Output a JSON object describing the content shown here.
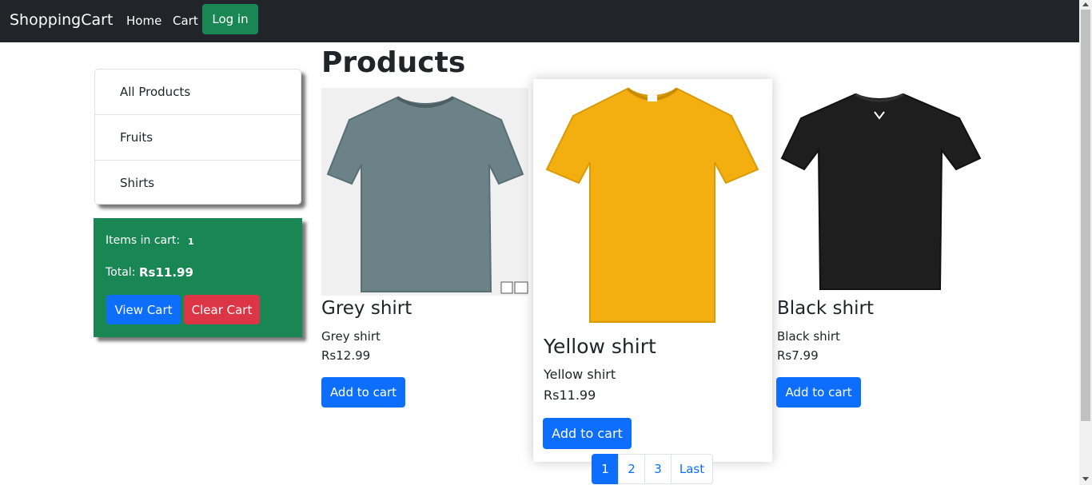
{
  "navbar": {
    "brand": "ShoppingCart",
    "links": [
      "Home",
      "Cart"
    ],
    "login_label": "Log in"
  },
  "page_title": "Products",
  "categories": [
    "All Products",
    "Fruits",
    "Shirts"
  ],
  "cart": {
    "items_label": "Items in cart:",
    "items_count": "1",
    "total_label": "Total:",
    "total_value": "Rs11.99",
    "view_label": "View Cart",
    "clear_label": "Clear Cart"
  },
  "products": [
    {
      "name": "Grey shirt",
      "desc": "Grey shirt",
      "price": "Rs12.99",
      "button": "Add to cart",
      "color": "#6b8288"
    },
    {
      "name": "Yellow shirt",
      "desc": "Yellow shirt",
      "price": "Rs11.99",
      "button": "Add to cart",
      "color": "#f3ae0f"
    },
    {
      "name": "Black shirt",
      "desc": "Black shirt",
      "price": "Rs7.99",
      "button": "Add to cart",
      "color": "#1e1e1e"
    }
  ],
  "pagination": [
    "1",
    "2",
    "3",
    "Last"
  ],
  "colors": {
    "primary": "#0d6efd",
    "success": "#198754",
    "danger": "#dc3545",
    "dark": "#212529"
  }
}
